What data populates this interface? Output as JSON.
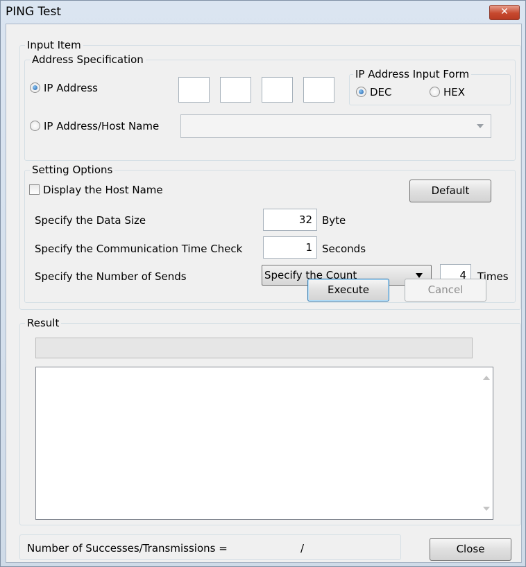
{
  "window": {
    "title": "PING Test"
  },
  "input_item": {
    "legend": "Input Item",
    "address_spec": {
      "legend": "Address Specification",
      "ip_address_label": "IP Address",
      "ip_address_selected": true,
      "octets": [
        "",
        "",
        "",
        ""
      ],
      "input_form": {
        "legend": "IP Address Input Form",
        "dec_label": "DEC",
        "hex_label": "HEX",
        "selected": "DEC"
      },
      "host_name_label": "IP Address/Host Name",
      "host_name_value": ""
    },
    "setting_options": {
      "legend": "Setting Options",
      "display_host_name_label": "Display the Host Name",
      "display_host_name_checked": false,
      "default_label": "Default",
      "data_size_label": "Specify the Data Size",
      "data_size_value": "32",
      "data_size_unit": "Byte",
      "time_check_label": "Specify the Communication Time Check",
      "time_check_value": "1",
      "time_check_unit": "Seconds",
      "sends_label": "Specify the Number of Sends",
      "sends_mode": "Specify the Count",
      "sends_value": "4",
      "sends_unit": "Times"
    },
    "execute_label": "Execute",
    "cancel_label": "Cancel"
  },
  "result": {
    "legend": "Result",
    "progress_text": "",
    "output_text": ""
  },
  "footer": {
    "successes_label": "Number of Successes/Transmissions =",
    "successes_value": "/",
    "close_label": "Close"
  },
  "colors": {
    "title_close_red": "#c7492f",
    "radio_dot": "#1f5ea8"
  }
}
